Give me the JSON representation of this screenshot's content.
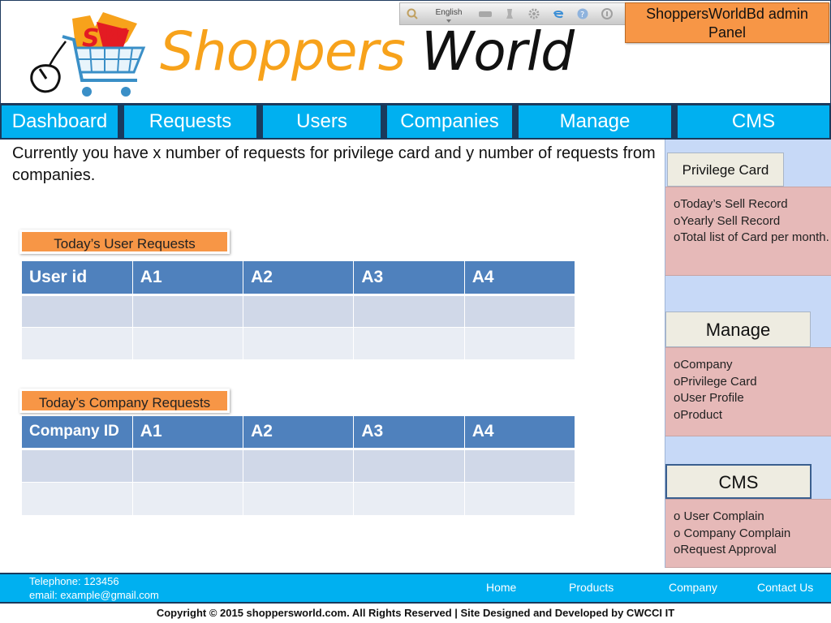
{
  "header": {
    "logo_part1": "Shoppers",
    "logo_part2": "World",
    "logo_badge": "SW",
    "language": "English",
    "admin_panel_title": "ShoppersWorldBd admin Panel"
  },
  "toolbar_icons": [
    "search-icon",
    "language-select",
    "keyboard-icon",
    "chess-icon",
    "gear-icon",
    "browser-icon",
    "help-icon",
    "info-icon"
  ],
  "nav": [
    "Dashboard",
    "Requests",
    "Users",
    "Companies",
    "Manage",
    "CMS"
  ],
  "intro_text": "Currently you have x number of requests for privilege card and y number of requests from companies.",
  "user_requests": {
    "label": "Today’s User Requests",
    "columns": [
      "User id",
      "A1",
      "A2",
      "A3",
      "A4"
    ]
  },
  "company_requests": {
    "label": "Today’s Company Requests",
    "columns": [
      "Company ID",
      "A1",
      "A2",
      "A3",
      "A4"
    ]
  },
  "sidebar": {
    "privilege": {
      "title": "Privilege Card",
      "items": [
        "Today’s Sell Record",
        "Yearly Sell Record",
        "Total list of Card per month."
      ]
    },
    "manage": {
      "title": "Manage",
      "items": [
        "Company",
        "Privilege Card",
        "User Profile",
        "Product"
      ]
    },
    "cms": {
      "title": "CMS",
      "items": [
        " User Complain",
        " Company Complain",
        "Request Approval"
      ]
    }
  },
  "footer": {
    "telephone": "Telephone: 123456",
    "email": "email: example@gmail.com",
    "links": [
      "Home",
      "Products",
      "Company",
      "Contact Us"
    ]
  },
  "copyright": "Copyright © 2015  shoppersworld.com. All Rights Reserved | Site Designed and Developed by CWCCI IT",
  "colors": {
    "nav_blue": "#00b0f0",
    "orange": "#f79646",
    "table_header": "#4f81bd",
    "sidebar_bg": "#c7d9f7",
    "sidebar_box": "#e6b9b8"
  }
}
